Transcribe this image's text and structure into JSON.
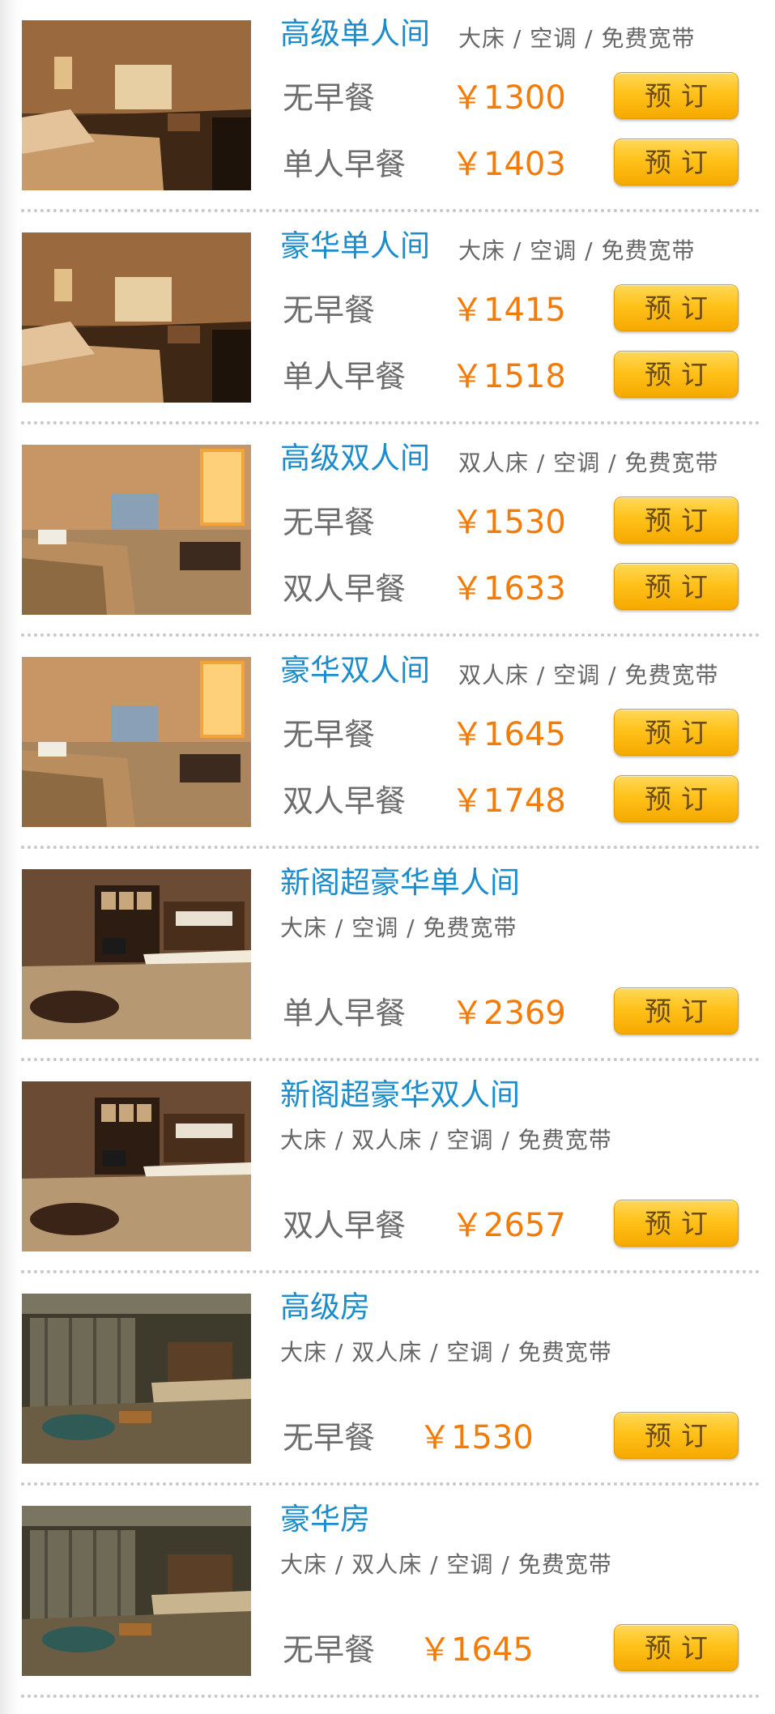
{
  "rooms": [
    {
      "name": "高级单人间",
      "features": "大床 / 空调 / 免费宽带",
      "rates": [
        {
          "meal": "无早餐",
          "price": "￥1300",
          "button": "预订"
        },
        {
          "meal": "单人早餐",
          "price": "￥1403",
          "button": "预订"
        }
      ]
    },
    {
      "name": "豪华单人间",
      "features": "大床 / 空调 / 免费宽带",
      "rates": [
        {
          "meal": "无早餐",
          "price": "￥1415",
          "button": "预订"
        },
        {
          "meal": "单人早餐",
          "price": "￥1518",
          "button": "预订"
        }
      ]
    },
    {
      "name": "高级双人间",
      "features": "双人床 / 空调 / 免费宽带",
      "rates": [
        {
          "meal": "无早餐",
          "price": "￥1530",
          "button": "预订"
        },
        {
          "meal": "双人早餐",
          "price": "￥1633",
          "button": "预订"
        }
      ]
    },
    {
      "name": "豪华双人间",
      "features": "双人床 / 空调 / 免费宽带",
      "rates": [
        {
          "meal": "无早餐",
          "price": "￥1645",
          "button": "预订"
        },
        {
          "meal": "双人早餐",
          "price": "￥1748",
          "button": "预订"
        }
      ]
    },
    {
      "name": "新阁超豪华单人间",
      "features": "大床 / 空调 / 免费宽带",
      "rates": [
        {
          "meal": "单人早餐",
          "price": "￥2369",
          "button": "预订"
        }
      ]
    },
    {
      "name": "新阁超豪华双人间",
      "features": "大床 / 双人床 / 空调 / 免费宽带",
      "rates": [
        {
          "meal": "双人早餐",
          "price": "￥2657",
          "button": "预订"
        }
      ]
    },
    {
      "name": "高级房",
      "features": "大床 / 双人床 / 空调 / 免费宽带",
      "rates": [
        {
          "meal": "无早餐",
          "price": "￥1530",
          "button": "预订"
        }
      ]
    },
    {
      "name": "豪华房",
      "features": "大床 / 双人床 / 空调 / 免费宽带",
      "rates": [
        {
          "meal": "无早餐",
          "price": "￥1645",
          "button": "预订"
        }
      ]
    }
  ],
  "colors": {
    "title": "#1b8ccc",
    "price": "#f47b06",
    "button": "#ffc21a",
    "meal": "#6d6d6d"
  },
  "icons": {
    "photo": "hotel-room-photo"
  }
}
